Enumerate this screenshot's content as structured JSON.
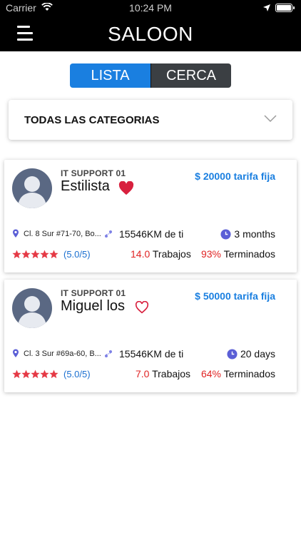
{
  "status_bar": {
    "carrier": "Carrier",
    "time": "10:24 PM"
  },
  "header": {
    "title": "SALOON"
  },
  "segments": {
    "list": "LISTA",
    "near": "CERCA"
  },
  "category": {
    "label": "TODAS LAS CATEGORIAS"
  },
  "cards": [
    {
      "company": "IT SUPPORT 01",
      "name": "Estilista",
      "favorite": true,
      "price": "$ 20000 tarifa fija",
      "address": "Cl. 8 Sur #71-70, Bo...",
      "distance": "15546KM de ti",
      "duration": "3 months",
      "rating": "(5.0/5)",
      "stars": 5,
      "jobs_count": "14.0",
      "jobs_label": "Trabajos",
      "done_pct": "93%",
      "done_label": "Terminados"
    },
    {
      "company": "IT SUPPORT 01",
      "name": "Miguel los",
      "favorite": false,
      "price": "$ 50000 tarifa fija",
      "address": "Cl. 3 Sur #69a-60, B...",
      "distance": "15546KM de ti",
      "duration": "20 days",
      "rating": "(5.0/5)",
      "stars": 5,
      "jobs_count": "7.0",
      "jobs_label": "Trabajos",
      "done_pct": "64%",
      "done_label": "Terminados"
    }
  ],
  "colors": {
    "accent": "#1a7fe0",
    "heart": "#d8203e",
    "stars": "#e53945",
    "highlight": "#e02424"
  }
}
